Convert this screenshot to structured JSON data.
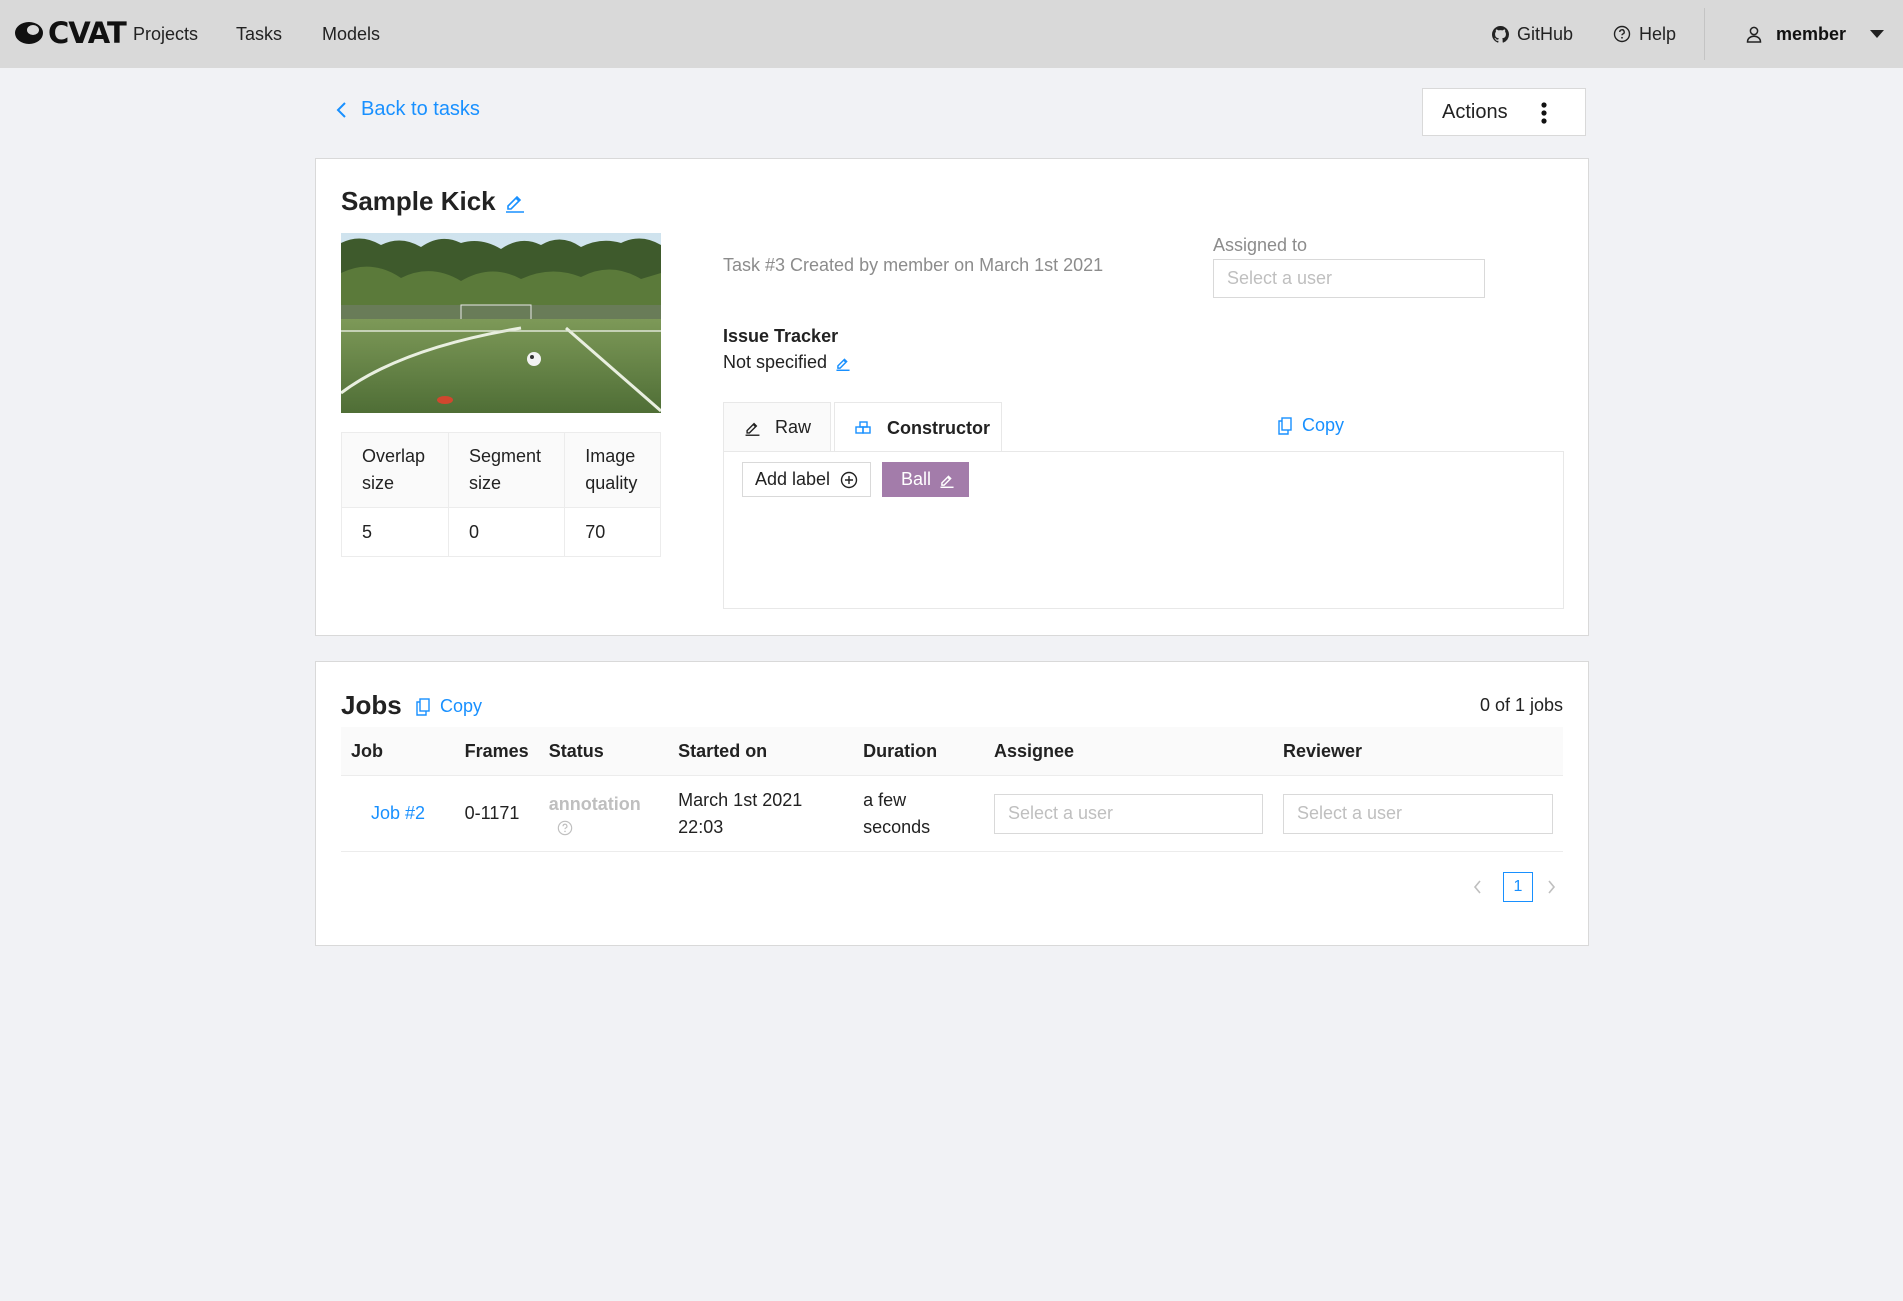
{
  "header": {
    "logo_text": "CVAT",
    "nav": [
      "Projects",
      "Tasks",
      "Models"
    ],
    "github_label": "GitHub",
    "help_label": "Help",
    "username": "member"
  },
  "toolbar": {
    "back_label": "Back to tasks",
    "actions_label": "Actions"
  },
  "task": {
    "title": "Sample Kick",
    "info": "Task #3 Created by member on March 1st 2021",
    "assigned_label": "Assigned to",
    "assignee_placeholder": "Select a user",
    "issue_tracker_label": "Issue Tracker",
    "issue_tracker_value": "Not specified",
    "params": {
      "headers": [
        [
          "Overlap",
          "size"
        ],
        [
          "Segment",
          "size"
        ],
        [
          "Image",
          "quality"
        ]
      ],
      "values": [
        "5",
        "0",
        "70"
      ]
    },
    "tabs": [
      "Raw",
      "Constructor"
    ],
    "active_tab": "Constructor",
    "copy_label": "Copy",
    "add_label": "Add label",
    "labels": [
      {
        "name": "Ball",
        "color": "#a37caa"
      }
    ]
  },
  "jobs": {
    "title": "Jobs",
    "copy_label": "Copy",
    "count": "0 of 1 jobs",
    "columns": [
      "Job",
      "Frames",
      "Status",
      "Started on",
      "Duration",
      "Assignee",
      "Reviewer"
    ],
    "rows": [
      {
        "job": "Job #2",
        "frames": "0-1171",
        "status": "annotation",
        "started_line1": "March 1st 2021",
        "started_line2": "22:03",
        "duration_line1": "a few",
        "duration_line2": "seconds",
        "assignee_placeholder": "Select a user",
        "reviewer_placeholder": "Select a user"
      }
    ],
    "page": "1"
  },
  "colors": {
    "accent": "#1890ff",
    "header_bg": "#d9d9d9",
    "page_bg": "#f1f2f5",
    "label_ball": "#a37caa"
  }
}
